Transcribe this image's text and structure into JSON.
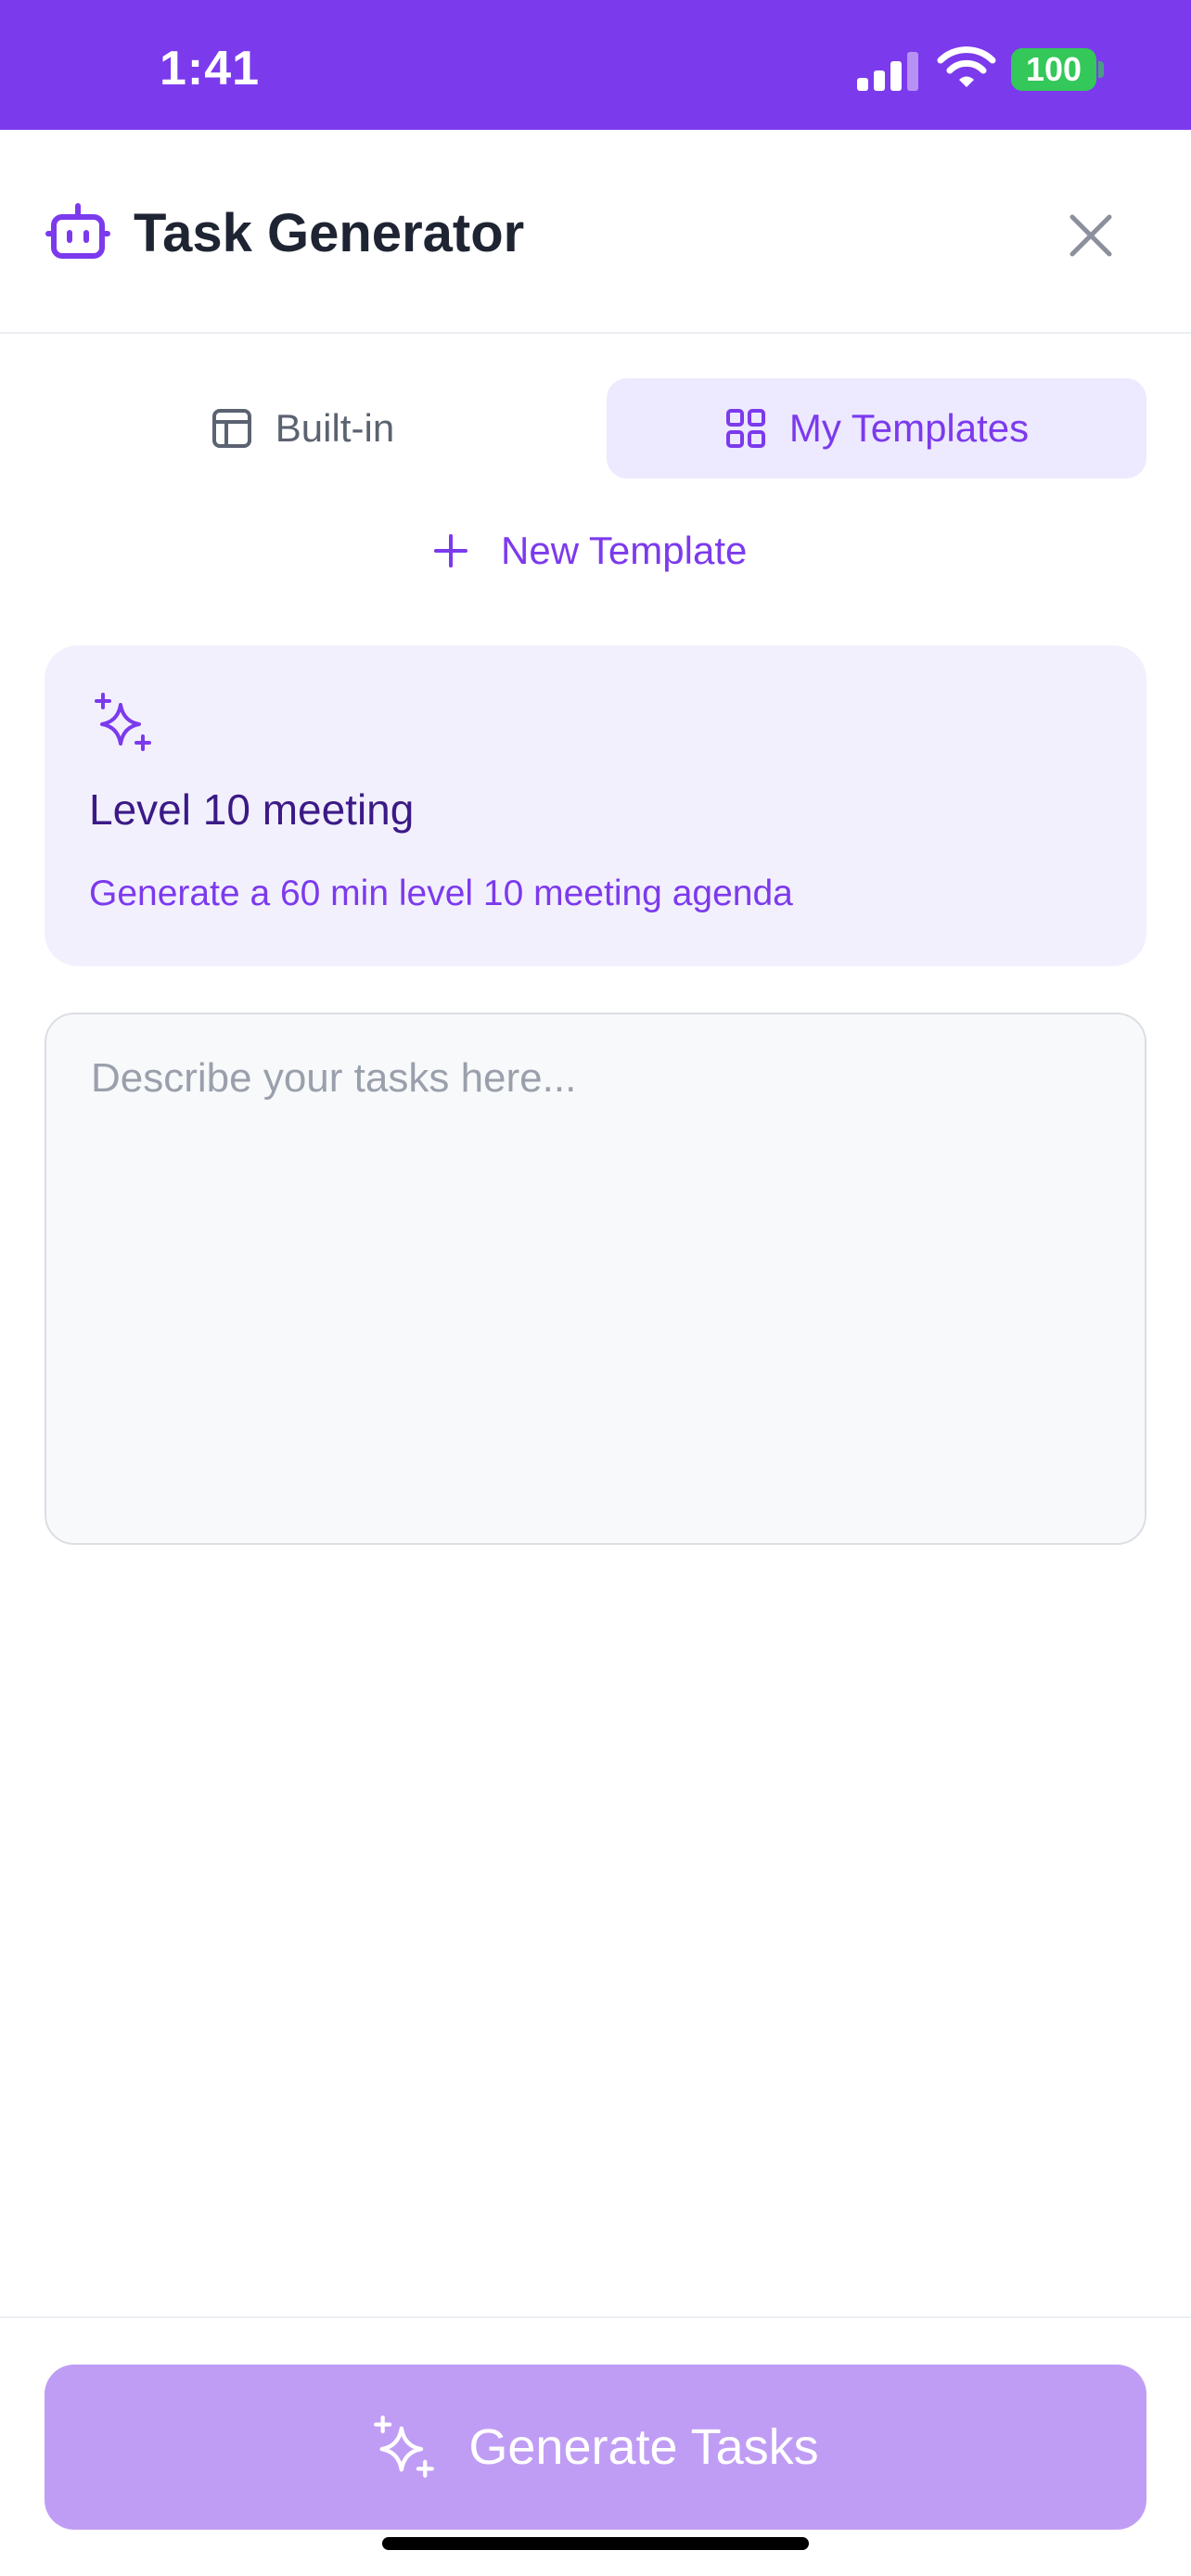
{
  "status_bar": {
    "time": "1:41",
    "battery": "100",
    "background_color": "#7c3aed",
    "battery_color": "#34c759",
    "icons": [
      "signal-icon",
      "wifi-icon",
      "battery-icon"
    ]
  },
  "header": {
    "title": "Task Generator",
    "icon": "robot-icon",
    "close_icon": "close-icon"
  },
  "tabs": [
    {
      "label": "Built-in",
      "icon": "layout-icon",
      "selected": false
    },
    {
      "label": "My Templates",
      "icon": "grid-icon",
      "selected": true
    }
  ],
  "new_template": {
    "label": "New Template",
    "icon": "plus-icon"
  },
  "templates": [
    {
      "title": "Level 10 meeting",
      "description": "Generate a 60 min level 10 meeting agenda",
      "icon": "sparkles-icon"
    }
  ],
  "task_input": {
    "placeholder": "Describe your tasks here...",
    "value": ""
  },
  "generate_button": {
    "label": "Generate Tasks",
    "icon": "sparkles-icon",
    "color": "#c09df5"
  },
  "theme": {
    "accent": "#7c3aed",
    "accent_light": "#ede9fe",
    "card_background": "#f3f0fe"
  }
}
